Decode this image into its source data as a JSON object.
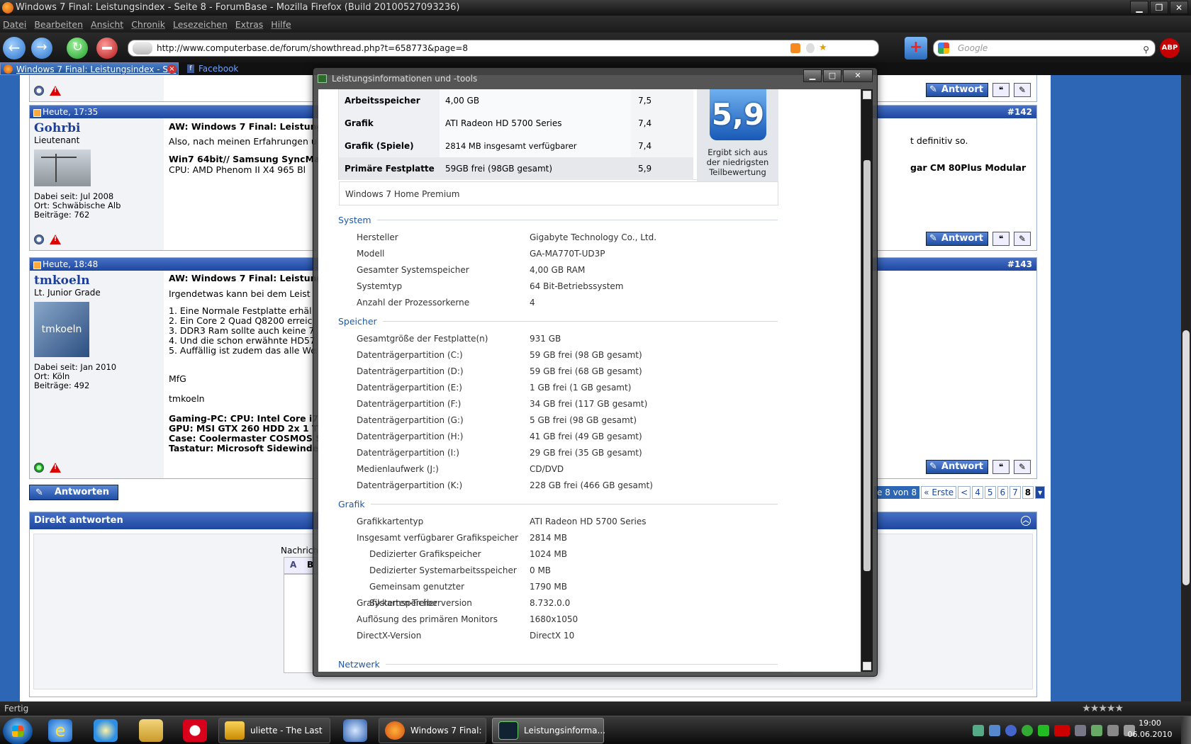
{
  "window_title": "Windows 7 Final: Leistungsindex - Seite 8 - ForumBase - Mozilla Firefox (Build 20100527093236)",
  "menu": [
    "Datei",
    "Bearbeiten",
    "Ansicht",
    "Chronik",
    "Lesezeichen",
    "Extras",
    "Hilfe"
  ],
  "url": "http://www.computerbase.de/forum/showthread.php?t=658773&page=8",
  "search_placeholder": "Google",
  "abp_label": "ABP",
  "tabs": [
    {
      "label": "Windows 7 Final: Leistungsindex - S..."
    },
    {
      "label": "Facebook"
    }
  ],
  "posts": [
    {
      "date": "Heute, 17:35",
      "num": "#142",
      "user": "Gohrbi",
      "rank": "Lieutenant",
      "joined": "Dabei seit: Jul 2008",
      "location": "Ort: Schwäbische Alb",
      "count": "Beiträge: 762",
      "title": "AW: Windows 7 Final: Leistungs",
      "lines": [
        "Also, nach meinen Erfahrungen u",
        "Win7 64bit// Samsung SyncMas",
        "CPU: AMD Phenom II X4 965 Bl"
      ],
      "right_lines": [
        "t definitiv so.",
        "gar CM 80Plus Modular"
      ]
    },
    {
      "date": "Heute, 18:48",
      "num": "#143",
      "user": "tmkoeln",
      "rank": "Lt. Junior Grade",
      "avatar": "tmkoeln",
      "joined": "Dabei seit: Jan 2010",
      "location": "Ort: Köln",
      "count": "Beiträge: 492",
      "title": "AW: Windows 7 Final: Leistungs",
      "lines": [
        "Irgendetwas kann bei dem Leist",
        "1. Eine Normale Festplatte erhäl",
        "2. Ein Core 2 Quad Q8200 erreic",
        "3. DDR3 Ram sollte auch keine 7",
        "4. Und die schon erwähnte HD57",
        "5. Auffällig ist zudem das alle We",
        "MfG",
        "tmkoeln",
        "Gaming-PC: CPU: Intel Core i7 8",
        "GPU: MSI GTX 260 HDD 2x 1 TB",
        "Case: Coolermaster COSMOS S (",
        "Tastatur: Microsoft Sidewinder X"
      ]
    }
  ],
  "antwort_label": "Antwort",
  "antworten_label": "Antworten",
  "pager": {
    "label": "e 8 von 8",
    "first": "« Erste",
    "prev": "<",
    "pages": [
      "4",
      "5",
      "6",
      "7",
      "8"
    ]
  },
  "quick_reply": {
    "title": "Direkt antworten",
    "label": "Nachrich"
  },
  "status": "Fertig",
  "taskbar": {
    "items": [
      "uliette - The Last ...",
      "Windows 7 Final: ...",
      "Leistungsinforma..."
    ],
    "time": "19:00",
    "date": "06.06.2010"
  },
  "dialog": {
    "title": "Leistungsinformationen und -tools",
    "wei_rows": [
      {
        "k": "Arbeitsspeicher (RAM)",
        "v": "4,00 GB",
        "s": "7,5"
      },
      {
        "k": "Grafik",
        "v": "ATI Radeon HD 5700 Series",
        "s": "7,4"
      },
      {
        "k": "Grafik (Spiele)",
        "v": "2814 MB insgesamt verfügbarer Grafikspeicher",
        "s": "7,4"
      },
      {
        "k": "Primäre Festplatte",
        "v": "59GB frei (98GB gesamt)",
        "s": "5,9"
      }
    ],
    "base_score": "5,9",
    "base_caption": [
      "Ergibt sich aus",
      "der niedrigsten",
      "Teilbewertung"
    ],
    "edition": "Windows 7 Home Premium",
    "sections": [
      {
        "title": "System",
        "rows": [
          {
            "k": "Hersteller",
            "v": "Gigabyte Technology Co., Ltd."
          },
          {
            "k": "Modell",
            "v": "GA-MA770T-UD3P"
          },
          {
            "k": "Gesamter Systemspeicher",
            "v": "4,00 GB RAM"
          },
          {
            "k": "Systemtyp",
            "v": "64 Bit-Betriebssystem"
          },
          {
            "k": "Anzahl der Prozessorkerne",
            "v": "4"
          }
        ]
      },
      {
        "title": "Speicher",
        "rows": [
          {
            "k": "Gesamtgröße der Festplatte(n)",
            "v": "931 GB"
          },
          {
            "k": "Datenträgerpartition (C:)",
            "v": "59 GB frei (98 GB gesamt)"
          },
          {
            "k": "Datenträgerpartition (D:)",
            "v": "59 GB frei (68 GB gesamt)"
          },
          {
            "k": "Datenträgerpartition (E:)",
            "v": "1 GB frei (1 GB gesamt)"
          },
          {
            "k": "Datenträgerpartition (F:)",
            "v": "34 GB frei (117 GB gesamt)"
          },
          {
            "k": "Datenträgerpartition (G:)",
            "v": "5 GB frei (98 GB gesamt)"
          },
          {
            "k": "Datenträgerpartition (H:)",
            "v": "41 GB frei (49 GB gesamt)"
          },
          {
            "k": "Datenträgerpartition (I:)",
            "v": "29 GB frei (35 GB gesamt)"
          },
          {
            "k": "Medienlaufwerk (J:)",
            "v": "CD/DVD"
          },
          {
            "k": "Datenträgerpartition (K:)",
            "v": "228 GB frei (466 GB gesamt)"
          }
        ]
      },
      {
        "title": "Grafik",
        "rows": [
          {
            "k": "Grafikkartentyp",
            "v": "ATI Radeon HD 5700 Series"
          },
          {
            "k": "Insgesamt verfügbarer Grafikspeicher",
            "v": "2814 MB"
          },
          {
            "k": "Dedizierter Grafikspeicher",
            "v": "1024 MB",
            "indent": true
          },
          {
            "k": "Dedizierter Systemarbeitsspeicher",
            "v": "0 MB",
            "indent": true
          },
          {
            "k": "Gemeinsam genutzter Systemspeicher",
            "v": "1790 MB",
            "indent": true
          },
          {
            "k": "Grafikkarten-Treiberversion",
            "v": "8.732.0.0"
          },
          {
            "k": "Auflösung des primären Monitors",
            "v": "1680x1050"
          },
          {
            "k": "DirectX-Version",
            "v": "DirectX 10"
          }
        ]
      },
      {
        "title": "Netzwerk",
        "rows": []
      }
    ]
  }
}
